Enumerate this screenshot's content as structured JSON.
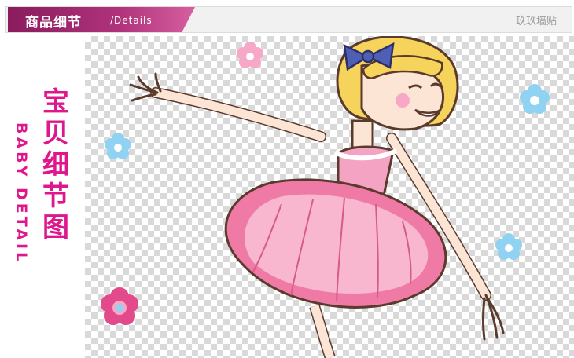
{
  "header": {
    "title": "商品细节",
    "subtitle": "/Details",
    "brand": "玖玖墙贴"
  },
  "sidebar": {
    "title_cn": "宝贝细节图",
    "title_en": "BABY DETAIL"
  },
  "illustration": {
    "icons": [
      "ballerina-girl-illustration",
      "flower-icon"
    ],
    "colors": {
      "tutu": "#f07aa6",
      "tutu_light": "#f9b7cf",
      "hair": "#f6d35a",
      "bow": "#4f5fb5",
      "skin": "#fde5d6",
      "flower_pink": "#f6a8c6",
      "flower_blue": "#8fd2f1",
      "flower_dark": "#e24a8c",
      "accent": "#e0178c"
    }
  }
}
